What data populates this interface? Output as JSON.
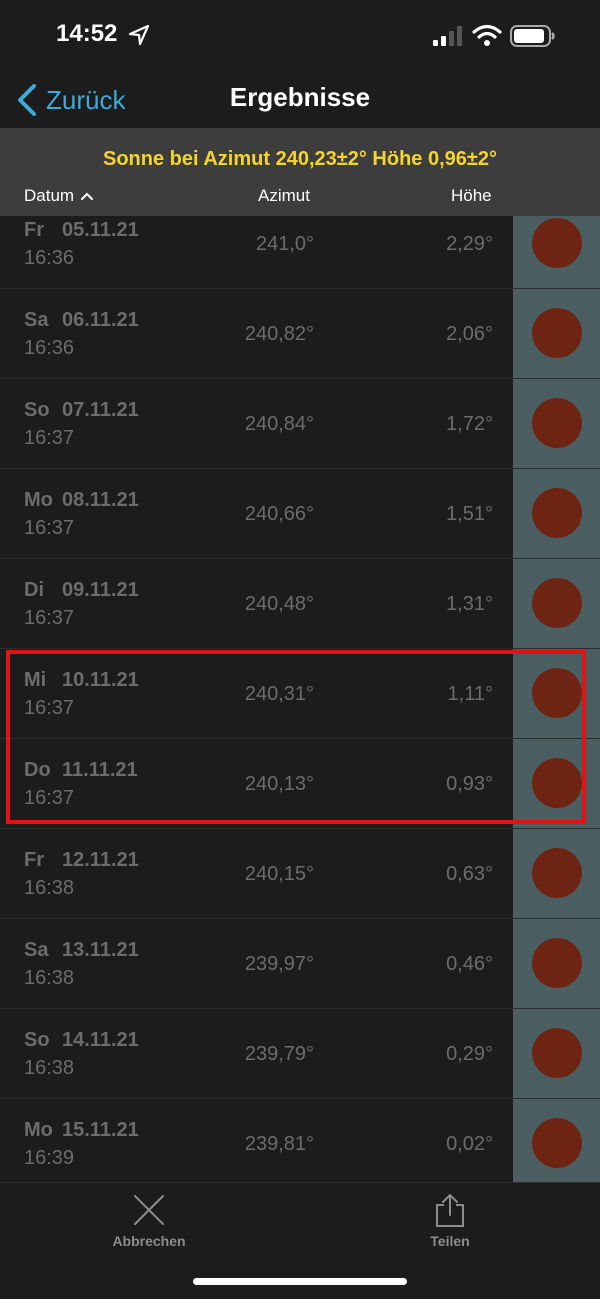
{
  "status": {
    "time": "14:52"
  },
  "nav": {
    "back_label": "Zurück",
    "title": "Ergebnisse"
  },
  "summary": {
    "text": "Sonne bei Azimut 240,23±2° Höhe 0,96±2°"
  },
  "columns": {
    "datum": "Datum",
    "azimut": "Azimut",
    "hoehe": "Höhe"
  },
  "rows": [
    {
      "day": "Fr",
      "date": "05.11.21",
      "time": "16:36",
      "azimut": "241,0°",
      "hoehe": "2,29°"
    },
    {
      "day": "Sa",
      "date": "06.11.21",
      "time": "16:36",
      "azimut": "240,82°",
      "hoehe": "2,06°"
    },
    {
      "day": "So",
      "date": "07.11.21",
      "time": "16:37",
      "azimut": "240,84°",
      "hoehe": "1,72°"
    },
    {
      "day": "Mo",
      "date": "08.11.21",
      "time": "16:37",
      "azimut": "240,66°",
      "hoehe": "1,51°"
    },
    {
      "day": "Di",
      "date": "09.11.21",
      "time": "16:37",
      "azimut": "240,48°",
      "hoehe": "1,31°"
    },
    {
      "day": "Mi",
      "date": "10.11.21",
      "time": "16:37",
      "azimut": "240,31°",
      "hoehe": "1,11°"
    },
    {
      "day": "Do",
      "date": "11.11.21",
      "time": "16:37",
      "azimut": "240,13°",
      "hoehe": "0,93°"
    },
    {
      "day": "Fr",
      "date": "12.11.21",
      "time": "16:38",
      "azimut": "240,15°",
      "hoehe": "0,63°"
    },
    {
      "day": "Sa",
      "date": "13.11.21",
      "time": "16:38",
      "azimut": "239,97°",
      "hoehe": "0,46°"
    },
    {
      "day": "So",
      "date": "14.11.21",
      "time": "16:38",
      "azimut": "239,79°",
      "hoehe": "0,29°"
    },
    {
      "day": "Mo",
      "date": "15.11.21",
      "time": "16:39",
      "azimut": "239,81°",
      "hoehe": "0,02°"
    }
  ],
  "toolbar": {
    "cancel_label": "Abbrechen",
    "share_label": "Teilen"
  },
  "colors": {
    "accent": "#3fa9d8",
    "summary_text": "#f5d42e",
    "highlight": "#e01414",
    "sun": "#6e2412",
    "thumb_bg": "#4b5f62"
  },
  "icons": {
    "back": "chevron-left-icon",
    "sort": "chevron-up-icon",
    "cancel": "close-icon",
    "share": "share-icon"
  }
}
